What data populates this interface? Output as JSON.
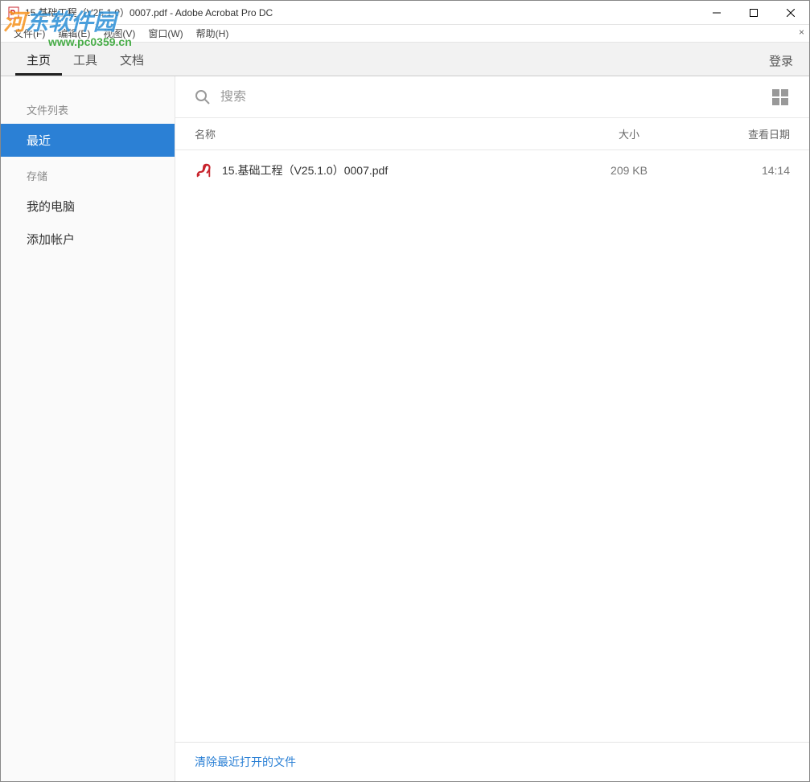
{
  "titlebar": {
    "title": "15.基础工程（V25.1.0）0007.pdf - Adobe Acrobat Pro DC"
  },
  "menubar": {
    "items": [
      "文件(F)",
      "编辑(E)",
      "视图(V)",
      "窗口(W)",
      "帮助(H)"
    ]
  },
  "tabs": {
    "home": "主页",
    "tools": "工具",
    "doc": "文档",
    "login": "登录"
  },
  "sidebar": {
    "filelist_label": "文件列表",
    "recent": "最近",
    "storage_label": "存储",
    "mycomputer": "我的电脑",
    "addaccount": "添加帐户"
  },
  "search": {
    "placeholder": "搜索"
  },
  "columns": {
    "name": "名称",
    "size": "大小",
    "date": "查看日期"
  },
  "files": [
    {
      "name": "15.基础工程（V25.1.0）0007.pdf",
      "size": "209 KB",
      "date": "14:14"
    }
  ],
  "footer": {
    "clear": "清除最近打开的文件"
  },
  "watermark": {
    "line1a": "河",
    "line1b": "东软件园",
    "line2": "www.pc0359.cn"
  }
}
